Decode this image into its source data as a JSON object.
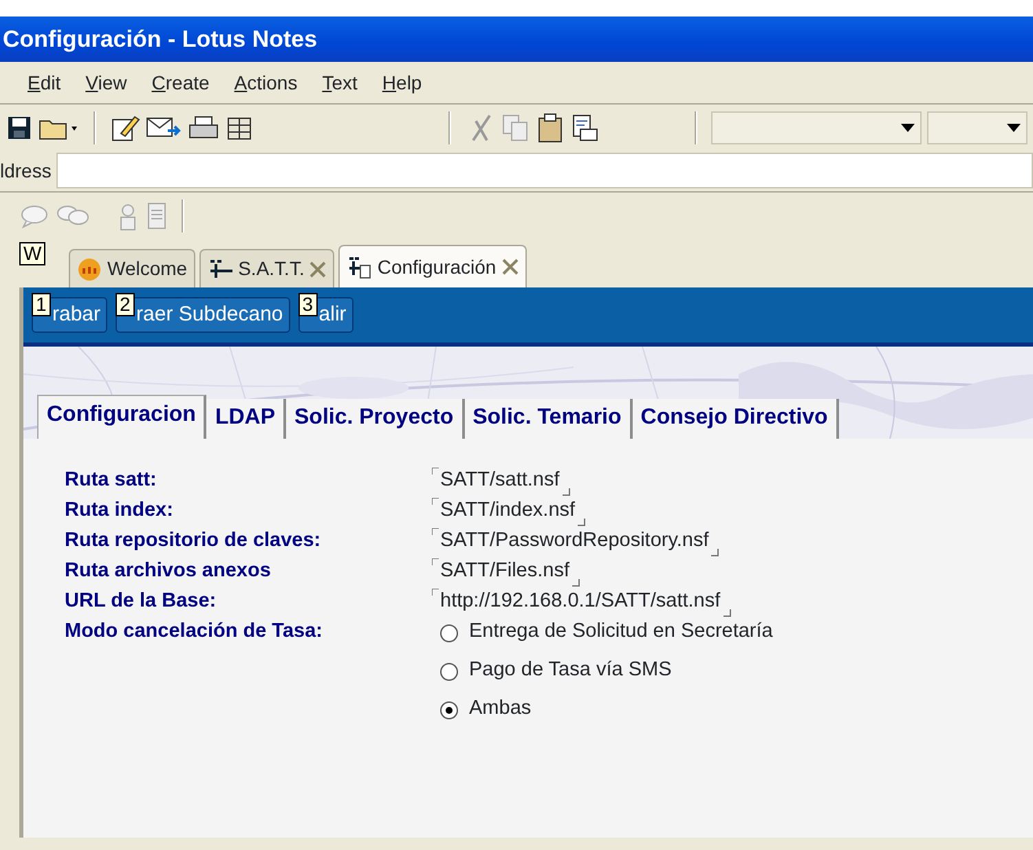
{
  "window": {
    "title": "Configuración  - Lotus Notes"
  },
  "menu": [
    "Edit",
    "View",
    "Create",
    "Actions",
    "Text",
    "Help"
  ],
  "address": {
    "label": "ldress"
  },
  "doc_tabs": [
    {
      "label": "Welcome",
      "kind": "welcome",
      "closable": false,
      "selected": false,
      "hotkey": "W"
    },
    {
      "label": "S.A.T.T.",
      "kind": "db",
      "closable": true,
      "selected": false
    },
    {
      "label": "Configuración",
      "kind": "doc",
      "closable": true,
      "selected": true
    }
  ],
  "actions": [
    {
      "hotkey": "1",
      "label": "rabar"
    },
    {
      "hotkey": "2",
      "label": "raer Subdecano"
    },
    {
      "hotkey": "3",
      "label": "alir"
    }
  ],
  "form_tabs": [
    {
      "label": "Configuracion",
      "selected": true
    },
    {
      "label": "LDAP",
      "selected": false
    },
    {
      "label": "Solic. Proyecto",
      "selected": false
    },
    {
      "label": "Solic. Temario",
      "selected": false
    },
    {
      "label": "Consejo Directivo",
      "selected": false
    }
  ],
  "fields": [
    {
      "label": "Ruta satt:",
      "kind": "text",
      "value": "SATT/satt.nsf"
    },
    {
      "label": "Ruta index:",
      "kind": "text",
      "value": "SATT/index.nsf"
    },
    {
      "label": "Ruta repositorio de claves:",
      "kind": "text",
      "value": "SATT/PasswordRepository.nsf"
    },
    {
      "label": "Ruta archivos anexos",
      "kind": "text",
      "value": "SATT/Files.nsf"
    },
    {
      "label": "URL de la Base:",
      "kind": "text",
      "value": "http://192.168.0.1/SATT/satt.nsf"
    },
    {
      "label": "Modo cancelación de Tasa:",
      "kind": "radio",
      "options": [
        {
          "label": "Entrega de Solicitud en Secretaría",
          "selected": false
        },
        {
          "label": "Pago de Tasa vía SMS",
          "selected": false
        },
        {
          "label": "Ambas",
          "selected": true
        }
      ]
    }
  ]
}
